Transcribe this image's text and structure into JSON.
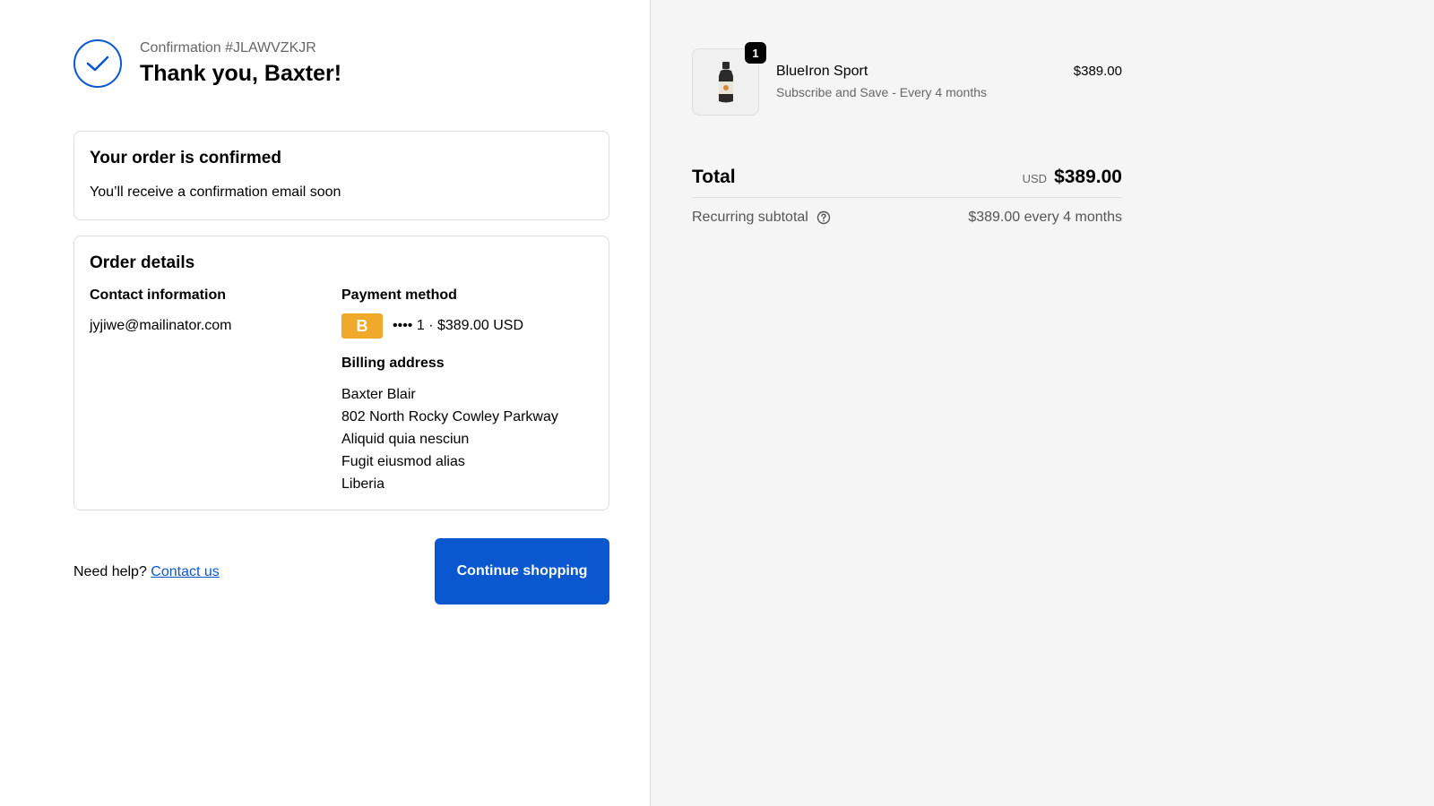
{
  "header": {
    "confirmation_number": "Confirmation #JLAWVZKJR",
    "thank_you": "Thank you, Baxter!"
  },
  "confirmed_card": {
    "title": "Your order is confirmed",
    "subtitle": "You’ll receive a confirmation email soon"
  },
  "order_details": {
    "title": "Order details",
    "contact_label": "Contact information",
    "contact_email": "jyjiwe@mailinator.com",
    "payment_label": "Payment method",
    "payment_brand_letter": "B",
    "payment_brand_color": "#f0a92a",
    "payment_text": "•••• 1 · $389.00 USD",
    "billing_label": "Billing address",
    "billing_lines": [
      "Baxter Blair",
      "802 North Rocky Cowley Parkway",
      "Aliquid quia nesciun",
      "Fugit eiusmod alias",
      "Liberia"
    ]
  },
  "footer": {
    "need_help": "Need help?",
    "contact_link": "Contact us",
    "continue_button": "Continue shopping"
  },
  "summary": {
    "product": {
      "quantity": "1",
      "name": "BlueIron Sport",
      "subtitle": "Subscribe and Save - Every 4 months",
      "price": "$389.00",
      "icon": "bottle-icon"
    },
    "total_label": "Total",
    "currency": "USD",
    "total_amount": "$389.00",
    "recurring_label": "Recurring subtotal",
    "recurring_value": "$389.00 every 4 months"
  },
  "colors": {
    "accent": "#0b57d0",
    "sidebar_bg": "#f5f5f5"
  }
}
